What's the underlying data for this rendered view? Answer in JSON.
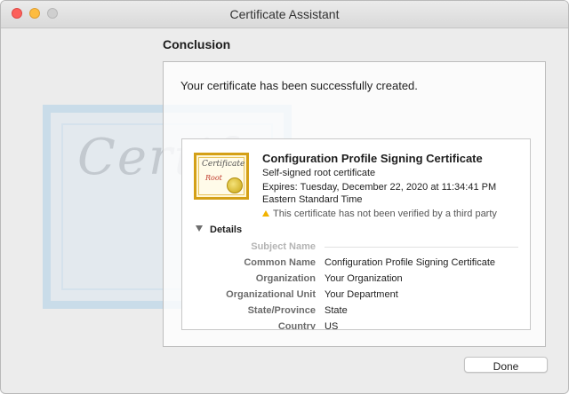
{
  "window": {
    "title": "Certificate Assistant"
  },
  "background_art": {
    "script_text": "Certif"
  },
  "section": {
    "title": "Conclusion"
  },
  "message": "Your certificate has been successfully created.",
  "certificate": {
    "icon_text": "Certificate",
    "icon_root_text": "Root",
    "name": "Configuration Profile Signing Certificate",
    "type": "Self-signed root certificate",
    "expires_line1": "Expires: Tuesday, December 22, 2020 at 11:34:41 PM",
    "expires_line2": "Eastern Standard Time",
    "warning_icon": "warning-triangle-icon",
    "warning": "This certificate has not been verified by a third party"
  },
  "details": {
    "toggle_label": "Details",
    "subject_name_header": "Subject Name",
    "rows": [
      {
        "label": "Common Name",
        "value": "Configuration Profile Signing Certificate"
      },
      {
        "label": "Organization",
        "value": "Your Organization"
      },
      {
        "label": "Organizational Unit",
        "value": "Your Department"
      },
      {
        "label": "State/Province",
        "value": "State"
      },
      {
        "label": "Country",
        "value": "US"
      }
    ]
  },
  "buttons": {
    "done": "Done"
  },
  "colors": {
    "close": "#fc605b",
    "minimize": "#fdbc40",
    "zoom_disabled": "#cfcfcf",
    "warning": "#f2b300"
  }
}
